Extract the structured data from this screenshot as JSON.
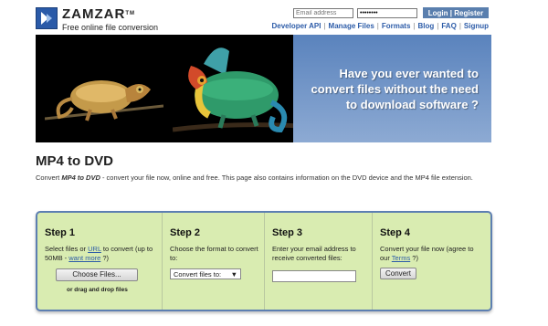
{
  "header": {
    "logo_name": "ZAMZAR",
    "logo_tm": "TM",
    "tagline": "Free online file conversion",
    "email_placeholder": "Email address",
    "password_value": "••••••••",
    "login_label": "Login | Register"
  },
  "nav": {
    "items": [
      "Developer API",
      "Manage Files",
      "Formats",
      "Blog",
      "FAQ",
      "Signup"
    ],
    "separator": "|"
  },
  "banner": {
    "line1": "Have you ever wanted to",
    "line2": "convert files without the need",
    "line3": "to download software ?"
  },
  "page": {
    "title": "MP4 to DVD",
    "desc_prefix": "Convert ",
    "desc_bold": "MP4 to DVD",
    "desc_rest": " - convert your file now, online and free. This page also contains information on the DVD device and the MP4 file extension."
  },
  "steps": {
    "step1": {
      "title": "Step 1",
      "text_a": "Select files or ",
      "link_url": "URL",
      "text_b": " to convert (up to 50MB - ",
      "link_more": "want more",
      "text_c": " ?)",
      "choose_label": "Choose Files...",
      "drag_label": "or drag and drop files"
    },
    "step2": {
      "title": "Step 2",
      "text": "Choose the format to convert to:",
      "select_value": "Convert files to:",
      "select_arrow": "▼"
    },
    "step3": {
      "title": "Step 3",
      "text": "Enter your email address to receive converted files:",
      "email_value": ""
    },
    "step4": {
      "title": "Step 4",
      "text_a": "Convert your file now (agree to our ",
      "link_terms": "Terms",
      "text_b": " ?)",
      "convert_label": "Convert"
    }
  },
  "colors": {
    "banner_blue": "#5a83bd",
    "panel_bg": "#d9ecb1",
    "panel_border": "#5d7fb2",
    "link": "#2d5ca8"
  }
}
